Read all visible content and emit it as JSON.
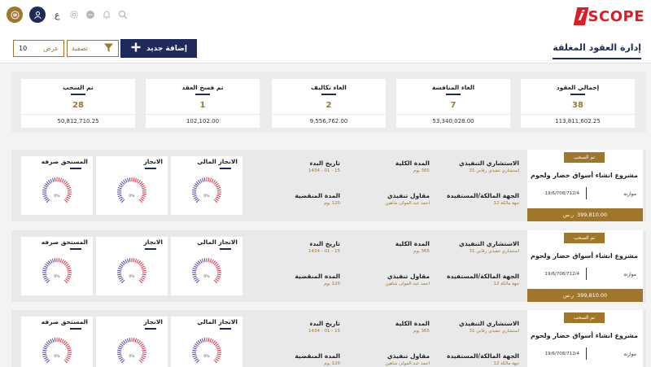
{
  "app": {
    "logo_i": "i",
    "logo_text": "SCOPE",
    "lang_label": "ع"
  },
  "header": {
    "title": "إدارة العقود المغلقة",
    "new_button": "إضافة جديد",
    "filter_button": "تصفية",
    "show_label": "عرض",
    "show_value": "10"
  },
  "stats": [
    {
      "title": "إجمالي العقود",
      "count": "38",
      "amount": "113,811,602.25"
    },
    {
      "title": "الغاء المنافسة",
      "count": "7",
      "amount": "53,340,028.00"
    },
    {
      "title": "الغاء تكاليف",
      "count": "2",
      "amount": "9,556,762.00"
    },
    {
      "title": "تم فسخ العقد",
      "count": "1",
      "amount": "102,102.00"
    },
    {
      "title": "تم السحب",
      "count": "28",
      "amount": "50,812,710.25"
    }
  ],
  "labels": {
    "consultant": "الاستشاري التنفيذي",
    "total_duration": "المدة الكلية",
    "start_date": "تاريخ البدء",
    "owner": "الجهة المالكة/المستفيدة",
    "contractor": "مقاول تنفيذي",
    "elapsed": "المدة المنقضية",
    "gauge_financial": "الانجاز المالي",
    "gauge_progress": "الانجاز",
    "gauge_due": "المستحق صرفه",
    "currency": "ر.س"
  },
  "contracts": [
    {
      "status": "تم السحب",
      "name": "مشروع انشاء أسواق خضار ولحوم",
      "type": "موازنة",
      "date": "19/6/708/712/4",
      "amount": "399,810.00",
      "consultant": "استشاري تنفيذي رقابي 31",
      "total_duration": "365 يوم",
      "start_date": "15 - 01 - 1434",
      "owner": "جهة مالكة 12",
      "contractor": "احمد عبد المولى شاهين",
      "elapsed": "120 يوم",
      "gauge_financial": "0%",
      "gauge_progress": "0%",
      "gauge_due": "0%"
    },
    {
      "status": "تم السحب",
      "name": "مشروع انشاء أسواق خضار ولحوم",
      "type": "موازنة",
      "date": "19/6/708/712/4",
      "amount": "399,810.00",
      "consultant": "استشاري تنفيذي رقابي 31",
      "total_duration": "365 يوم",
      "start_date": "15 - 01 - 1434",
      "owner": "جهة مالكة 12",
      "contractor": "احمد عبد المولى شاهين",
      "elapsed": "120 يوم",
      "gauge_financial": "0%",
      "gauge_progress": "0%",
      "gauge_due": "0%"
    },
    {
      "status": "تم السحب",
      "name": "مشروع انشاء أسواق خضار ولحوم",
      "type": "موازنة",
      "date": "19/6/708/712/4",
      "amount": "399,810.00",
      "consultant": "استشاري تنفيذي رقابي 31",
      "total_duration": "365 يوم",
      "start_date": "15 - 01 - 1434",
      "owner": "جهة مالكة 12",
      "contractor": "احمد عبد المولى شاهين",
      "elapsed": "120 يوم",
      "gauge_financial": "0%",
      "gauge_progress": "0%",
      "gauge_due": "0%"
    }
  ],
  "colors": {
    "navy": "#1f2a5c",
    "gold": "#a0762a",
    "logo_red": "#e11b22",
    "gauge_red": "#d9304a",
    "gauge_purple": "#5a3da8"
  },
  "icons": [
    "menu-icon",
    "user-icon",
    "gear-icon",
    "chat-icon",
    "bell-icon",
    "search-icon",
    "plus-icon",
    "filter-icon"
  ]
}
